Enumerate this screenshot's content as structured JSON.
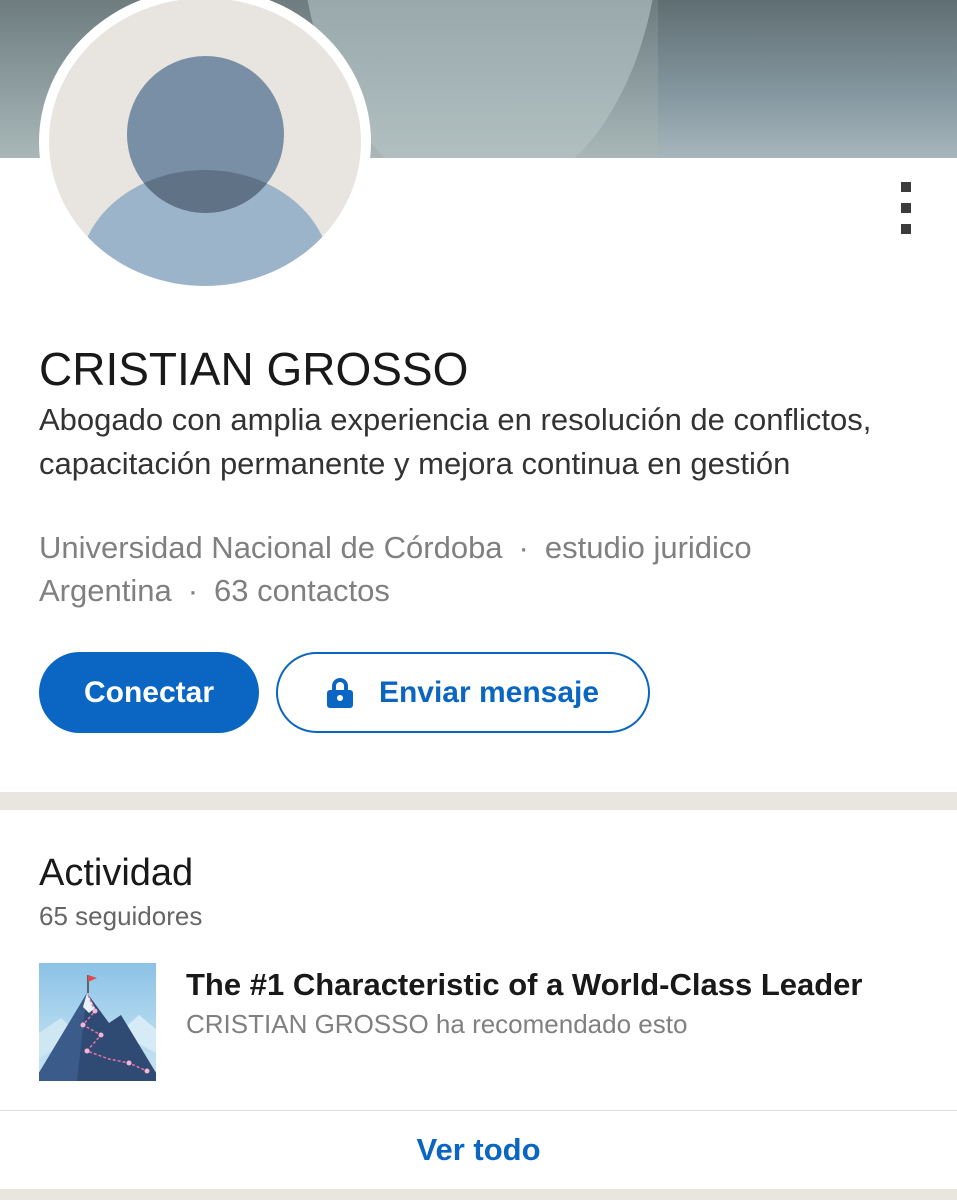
{
  "profile": {
    "name": "CRISTIAN GROSSO",
    "headline": "Abogado con amplia experiencia en resolución de conflictos, capacitación permanente y mejora continua en gestión",
    "education": "Universidad Nacional de Córdoba",
    "company": "estudio juridico",
    "location": "Argentina",
    "connections": "63 contactos",
    "separator": "·"
  },
  "actions": {
    "connect_label": "Conectar",
    "message_label": "Enviar mensaje",
    "message_icon": "lock-icon",
    "more_icon": "more-vertical-icon"
  },
  "activity": {
    "title": "Actividad",
    "followers": "65 seguidores",
    "items": [
      {
        "title": "The #1 Characteristic of a World-Class Leader",
        "subtitle": "CRISTIAN GROSSO ha recomendado esto",
        "thumbnail": "mountain-flag-image"
      }
    ],
    "see_all_label": "Ver todo"
  },
  "colors": {
    "accent": "#0a66c2",
    "text_primary": "#191919",
    "text_secondary": "#808080",
    "divider": "#e9e5df"
  }
}
